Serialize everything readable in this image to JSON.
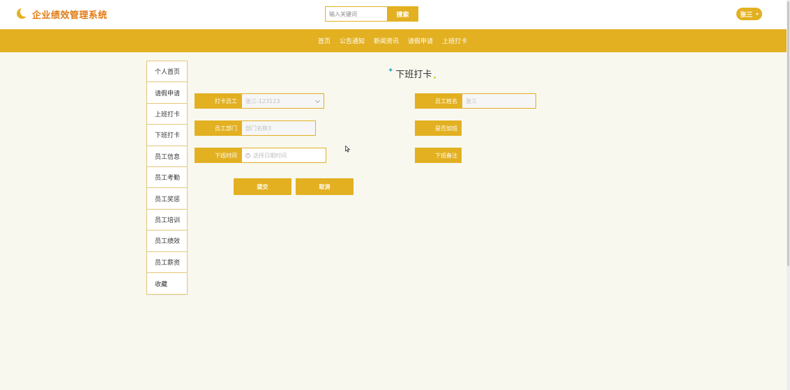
{
  "header": {
    "logo_text": "企业绩效管理系统",
    "search_placeholder": "输入关键词",
    "search_button": "搜索",
    "user_name": "张三"
  },
  "nav": {
    "items": [
      "首页",
      "公告通知",
      "新闻资讯",
      "请假申请",
      "上班打卡"
    ]
  },
  "sidebar": {
    "items": [
      "个人首页",
      "请假申请",
      "上班打卡",
      "下班打卡",
      "员工信息",
      "员工考勤",
      "员工奖惩",
      "员工培训",
      "员工绩效",
      "员工薪资",
      "收藏"
    ]
  },
  "page": {
    "title": "下班打卡"
  },
  "form": {
    "employee_label": "打卡员工",
    "employee_value": "张三-123123",
    "name_label": "员工姓名",
    "name_value": "张三",
    "dept_label": "员工部门",
    "dept_value": "部门名称3",
    "overtime_label": "是否加班",
    "time_label": "下班时间",
    "time_placeholder": "选择日期时间",
    "remark_label": "下班备注"
  },
  "buttons": {
    "submit": "提交",
    "cancel": "取消"
  },
  "icons": {
    "logo": "moon-icon",
    "user_dropdown": "caret-down-icon",
    "title_left": "star-icon",
    "select": "chevron-down-icon",
    "time": "clock-icon",
    "pointer": "mouse-cursor-icon"
  },
  "colors": {
    "accent": "#e2b021",
    "logo_text": "#e27a12",
    "background": "#f8f8ef"
  }
}
